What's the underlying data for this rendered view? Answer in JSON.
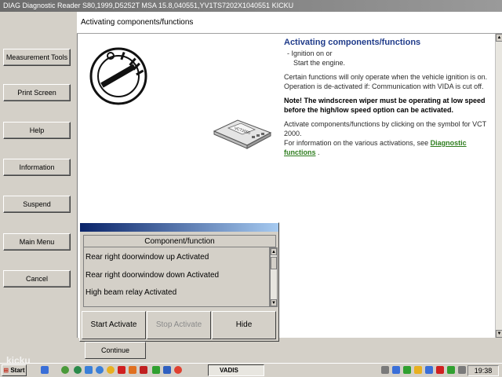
{
  "window": {
    "title": "DIAG Diagnostic Reader S80,1999,D5252T MSA 15.8,040551,YV1TS7202X1040551 KICKU"
  },
  "sidebar": {
    "items": [
      {
        "label": "Measurement Tools"
      },
      {
        "label": "Print Screen"
      },
      {
        "label": "Help"
      },
      {
        "label": "Information"
      },
      {
        "label": "Suspend"
      },
      {
        "label": "Main Menu"
      },
      {
        "label": "Cancel"
      }
    ]
  },
  "header": {
    "title": "Activating components/functions"
  },
  "info": {
    "heading": "Activating components/functions",
    "bullet_1": "- Ignition on or",
    "bullet_2": "Start the engine.",
    "para_1": "Certain functions will only operate when the vehicle ignition is on.",
    "para_2": "Operation is de-activated if: Communication with VIDA is cut off.",
    "note": "Note! The windscreen wiper must be operating at low speed before the high/low speed option can be activated.",
    "para_3": "Activate components/functions by clicking on the symbol for VCT 2000.",
    "para_4_prefix": "For information on the various activations, see",
    "link": "Diagnostic functions",
    "para_4_suffix": "."
  },
  "device": {
    "label": "VCT2000"
  },
  "dialog": {
    "column_header": "Component/function",
    "items": [
      "Rear right doorwindow up Activated",
      "Rear right doorwindow down Activated",
      "High beam relay Activated"
    ],
    "buttons": {
      "start": "Start Activate",
      "stop": "Stop Activate",
      "hide": "Hide"
    }
  },
  "continue_label": "Continue",
  "taskbar": {
    "start_label": "Start",
    "task_label": "VADIS",
    "clock": "19:38"
  },
  "watermark": "kicku",
  "colors": {
    "heading": "#1f3b8a",
    "link": "#2e7d1e",
    "dialog_bar": "#0a246a"
  }
}
